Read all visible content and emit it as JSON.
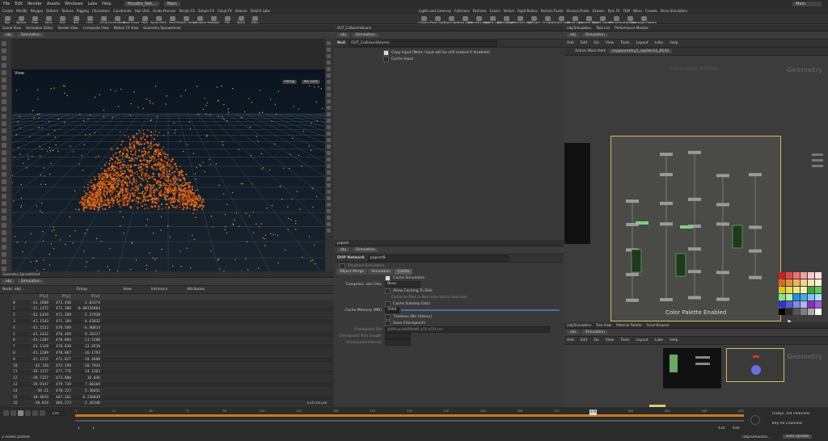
{
  "menu": [
    "File",
    "Edit",
    "Render",
    "Assets",
    "Windows",
    "Labs",
    "Help"
  ],
  "desktop": "Houdini_Net...",
  "main_desk": "Main",
  "main_desk_right": "Main",
  "shelf_tabs_left": [
    "Create",
    "Modify",
    "Polygon",
    "Deform",
    "Texture",
    "Rigging",
    "Characters",
    "Constraints",
    "Hair Utils",
    "Guide Process",
    "Terrain FX",
    "Simple FX",
    "Cloud FX",
    "Volume",
    "SideFX Labs"
  ],
  "shelf_tabs_right": [
    "Lights and Cameras",
    "Collisions",
    "Particles",
    "Grains",
    "Vellum",
    "Rigid Bodies",
    "Particle Fluids",
    "Viscous Fluids",
    "Oceans",
    "Pyro FX",
    "FEM",
    "Wires",
    "Crowds",
    "Drive Simulation"
  ],
  "tools_left": [
    "Box",
    "Sphere",
    "Tube",
    "Torus",
    "Grid",
    "Null",
    "Line",
    "Circle",
    "Curve Bezier",
    "Draw Curve",
    "Path",
    "Spray Paint",
    "Font",
    "Platonic Solids",
    "L-System",
    "Metaball",
    "File",
    "Spiral",
    "Helix"
  ],
  "tools_right": [
    "Camera",
    "Point Light",
    "Spot Light",
    "Area Light",
    "Geometry Light",
    "Volume Light",
    "Distant Light",
    "Environment Light",
    "Sky Light",
    "GI Light",
    "Caustic Light",
    "Portal Light",
    "Ambient Light",
    "Stereo Camera",
    "VR Camera",
    "Switcher",
    "Gamepad Camera"
  ],
  "left_tabs": [
    "Scene View",
    "Animation Editor",
    "Render View",
    "Composite View",
    "Motion FX View",
    "Geometry Spreadsheet"
  ],
  "left_path": "obj",
  "left_sim": "Simulation",
  "view_label": "View",
  "persp": "Persp",
  "nocam": "No cam",
  "fps": "103fps",
  "fps_sub": "9.7ms",
  "sheet_tab": "Geometry Spreadsheet",
  "sheet_toolbar": [
    "Node: obj/...",
    "Group",
    "View",
    "Intrinsics",
    "Attributes"
  ],
  "sheet_headers": [
    "",
    "P[x]",
    "P[y]",
    "P[z]"
  ],
  "sheet_rows": [
    [
      "0",
      "-41.1088",
      "473.446",
      "2.03374"
    ],
    [
      "1",
      "-41.1372",
      "472.388",
      "-0.00156864"
    ],
    [
      "2",
      "-41.1419",
      "471.389",
      "-2.37938"
    ],
    [
      "3",
      "-41.1543",
      "471.184",
      "-4.63832"
    ],
    [
      "4",
      "-41.1522",
      "470.569",
      "-6.90814"
    ],
    [
      "5",
      "-41.1432",
      "470.469",
      "-9.28127"
    ],
    [
      "6",
      "-41.1307",
      "470.094",
      "-11.5268"
    ],
    [
      "7",
      "-41.1129",
      "470.038",
      "-13.8539"
    ],
    [
      "8",
      "-41.1209",
      "470.067",
      "-16.1793"
    ],
    [
      "9",
      "-41.1215",
      "471.027",
      "-18.4888"
    ],
    [
      "10",
      "-41.126",
      "472.299",
      "-20.7924"
    ],
    [
      "11",
      "-39.2157",
      "477.776",
      "14.1363"
    ],
    [
      "12",
      "-39.7357",
      "473.806",
      "16.036"
    ],
    [
      "13",
      "-39.9147",
      "479.739",
      "7.60369"
    ],
    [
      "14",
      "-39.21",
      "470.227",
      "5.30451"
    ],
    [
      "15",
      "-38.9659",
      "467.261",
      "0.236039"
    ],
    [
      "16",
      "-38.834",
      "466.273",
      "-2.36346"
    ]
  ],
  "sheet_footer": "Extrusion",
  "mid_tab": "OUT_CollisionVolume",
  "mid_path": "obj",
  "mid_sim": "Simulation",
  "null_label": "Null",
  "null_name": "OUT_CollisionVolume",
  "null_parms": [
    {
      "label": "Copy Input (Note: Input will be still cooked if disabled)",
      "on": true
    },
    {
      "label": "Cache Input",
      "on": false
    }
  ],
  "pop_tab": "popnet",
  "dop_label": "DOP Network",
  "dop_name": "popnet8",
  "playback_label": "Playback Simulation",
  "parm_tabs": [
    "Object Merge",
    "Simulation",
    "Cache"
  ],
  "cache_sim": "Cache Simulation",
  "compress_label": "Compress .sim Files",
  "compress_value": "Blosc",
  "cache_parms": [
    {
      "label": "Allow Caching To Disk",
      "on": false
    },
    {
      "label": "Cache to Disk in Non-Interactive Sessions",
      "on": false
    },
    {
      "label": "Cache Substep Data",
      "on": false
    }
  ],
  "cache_mem_label": "Cache Memory (MB)",
  "cache_mem_value": "5000",
  "timeless": "Timeless (No History)",
  "save_chk": "Save Checkpoints",
  "checkpoint_file": "Checkpoint File",
  "checkpoint_path": "$HIP/sim/$HIPNAME.$OS.$SF4.sim",
  "checkpoint_trail": "Checkpoint Trail Length",
  "checkpoint_interval": "Checkpoint Interval",
  "net_tabs": [
    "/obj/Simulation",
    "Take List",
    "Performance Monitor"
  ],
  "net_path": "obj",
  "net_sim": "Simulation",
  "net_menu": [
    "Add",
    "Edit",
    "Go",
    "View",
    "Tools",
    "Layout",
    "Labs",
    "Help"
  ],
  "active_work": "Active Work Item",
  "topgeometry": "topgeometry1_ropfetch1_8143",
  "edition": "Education Edition",
  "geometry_label": "Geometry",
  "color_palette": "Color Palette Enabled",
  "palette_colors": [
    "#cc1f1f",
    "#e04a4a",
    "#f07070",
    "#f5a0a0",
    "#f8c8c8",
    "#ffe0e0",
    "#d86a1f",
    "#e89040",
    "#f0b060",
    "#f7d088",
    "#f9e4b0",
    "#fff4d8",
    "#d8c81f",
    "#e6dc50",
    "#eee880",
    "#f4f0a8",
    "#38a838",
    "#60c860",
    "#88e088",
    "#b0f0b0",
    "#1f8fd8",
    "#48a8e8",
    "#78c4f0",
    "#a8dcf8",
    "#2a38c8",
    "#5060d8",
    "#8088e8",
    "#b0b4f4",
    "#8a2ac8",
    "#a858d8",
    "#000000",
    "#2a2a2a",
    "#555555",
    "#808080",
    "#aaaaaa",
    "#ffffff"
  ],
  "net2_tabs": [
    "/obj/Simulation",
    "Tree View",
    "Material Palette",
    "Asset Browser"
  ],
  "net2_sim": "Simulation",
  "geometry_label2": "Geometry",
  "frame_current": "370",
  "frame_start": "1",
  "frame_start2": "1",
  "frame_end": "430",
  "frame_end2": "430",
  "ruler_marks": [
    "1",
    "24",
    "48",
    "72",
    "96",
    "120",
    "144",
    "168",
    "192",
    "216",
    "240",
    "264",
    "288",
    "312",
    "336",
    "360",
    "384",
    "408",
    "430"
  ],
  "keys_label": "0 keys, 0/4 channels",
  "key_all": "Key All Channels",
  "auto_update": "Auto Update",
  "status_left": "2 nodes pasted",
  "status_right": "/obj/Simulatio..."
}
